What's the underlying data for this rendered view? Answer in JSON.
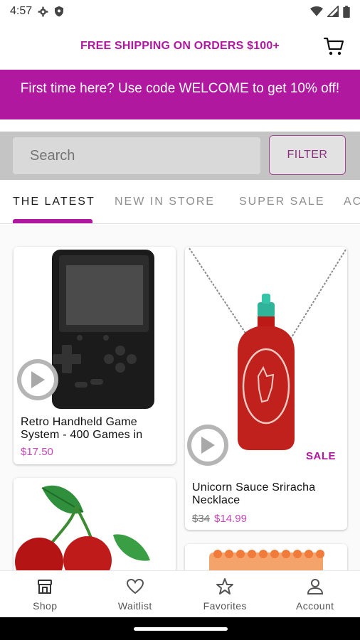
{
  "status_bar": {
    "time": "4:57",
    "icons": [
      "gear-icon",
      "shield-icon",
      "wifi-icon",
      "signal-icon",
      "battery-icon"
    ]
  },
  "header": {
    "shipping_text": "FREE SHIPPING ON ORDERS $100+",
    "cart_icon": "cart-icon"
  },
  "promo": {
    "text": "First time here? Use code WELCOME to get 10% off!"
  },
  "search": {
    "placeholder": "Search",
    "filter_label": "FILTER"
  },
  "tabs": [
    {
      "label": "THE LATEST",
      "active": true
    },
    {
      "label": "NEW IN STORE",
      "active": false
    },
    {
      "label": "SUPER SALE",
      "active": false
    },
    {
      "label": "AC",
      "active": false
    }
  ],
  "products": [
    {
      "title": "Retro Handheld Game System - 400 Games in",
      "price": "$17.50",
      "has_video": true,
      "sale": false
    },
    {
      "title": "Unicorn Sauce Sriracha Necklace",
      "old_price": "$34",
      "price": "$14.99",
      "has_video": true,
      "sale": true,
      "sale_label": "SALE"
    },
    {
      "title": "",
      "price": "",
      "has_video": false,
      "sale": false
    },
    {
      "title": "",
      "price": "",
      "has_video": false,
      "sale": false
    }
  ],
  "bottom_nav": [
    {
      "label": "Shop",
      "icon": "store-icon",
      "active": true
    },
    {
      "label": "Waitlist",
      "icon": "heart-icon",
      "active": false
    },
    {
      "label": "Favorites",
      "icon": "star-icon",
      "active": false
    },
    {
      "label": "Account",
      "icon": "account-icon",
      "active": false
    }
  ],
  "colors": {
    "brand": "#b0189f",
    "search_bg": "#c4c4c4",
    "price": "#c547b6"
  }
}
